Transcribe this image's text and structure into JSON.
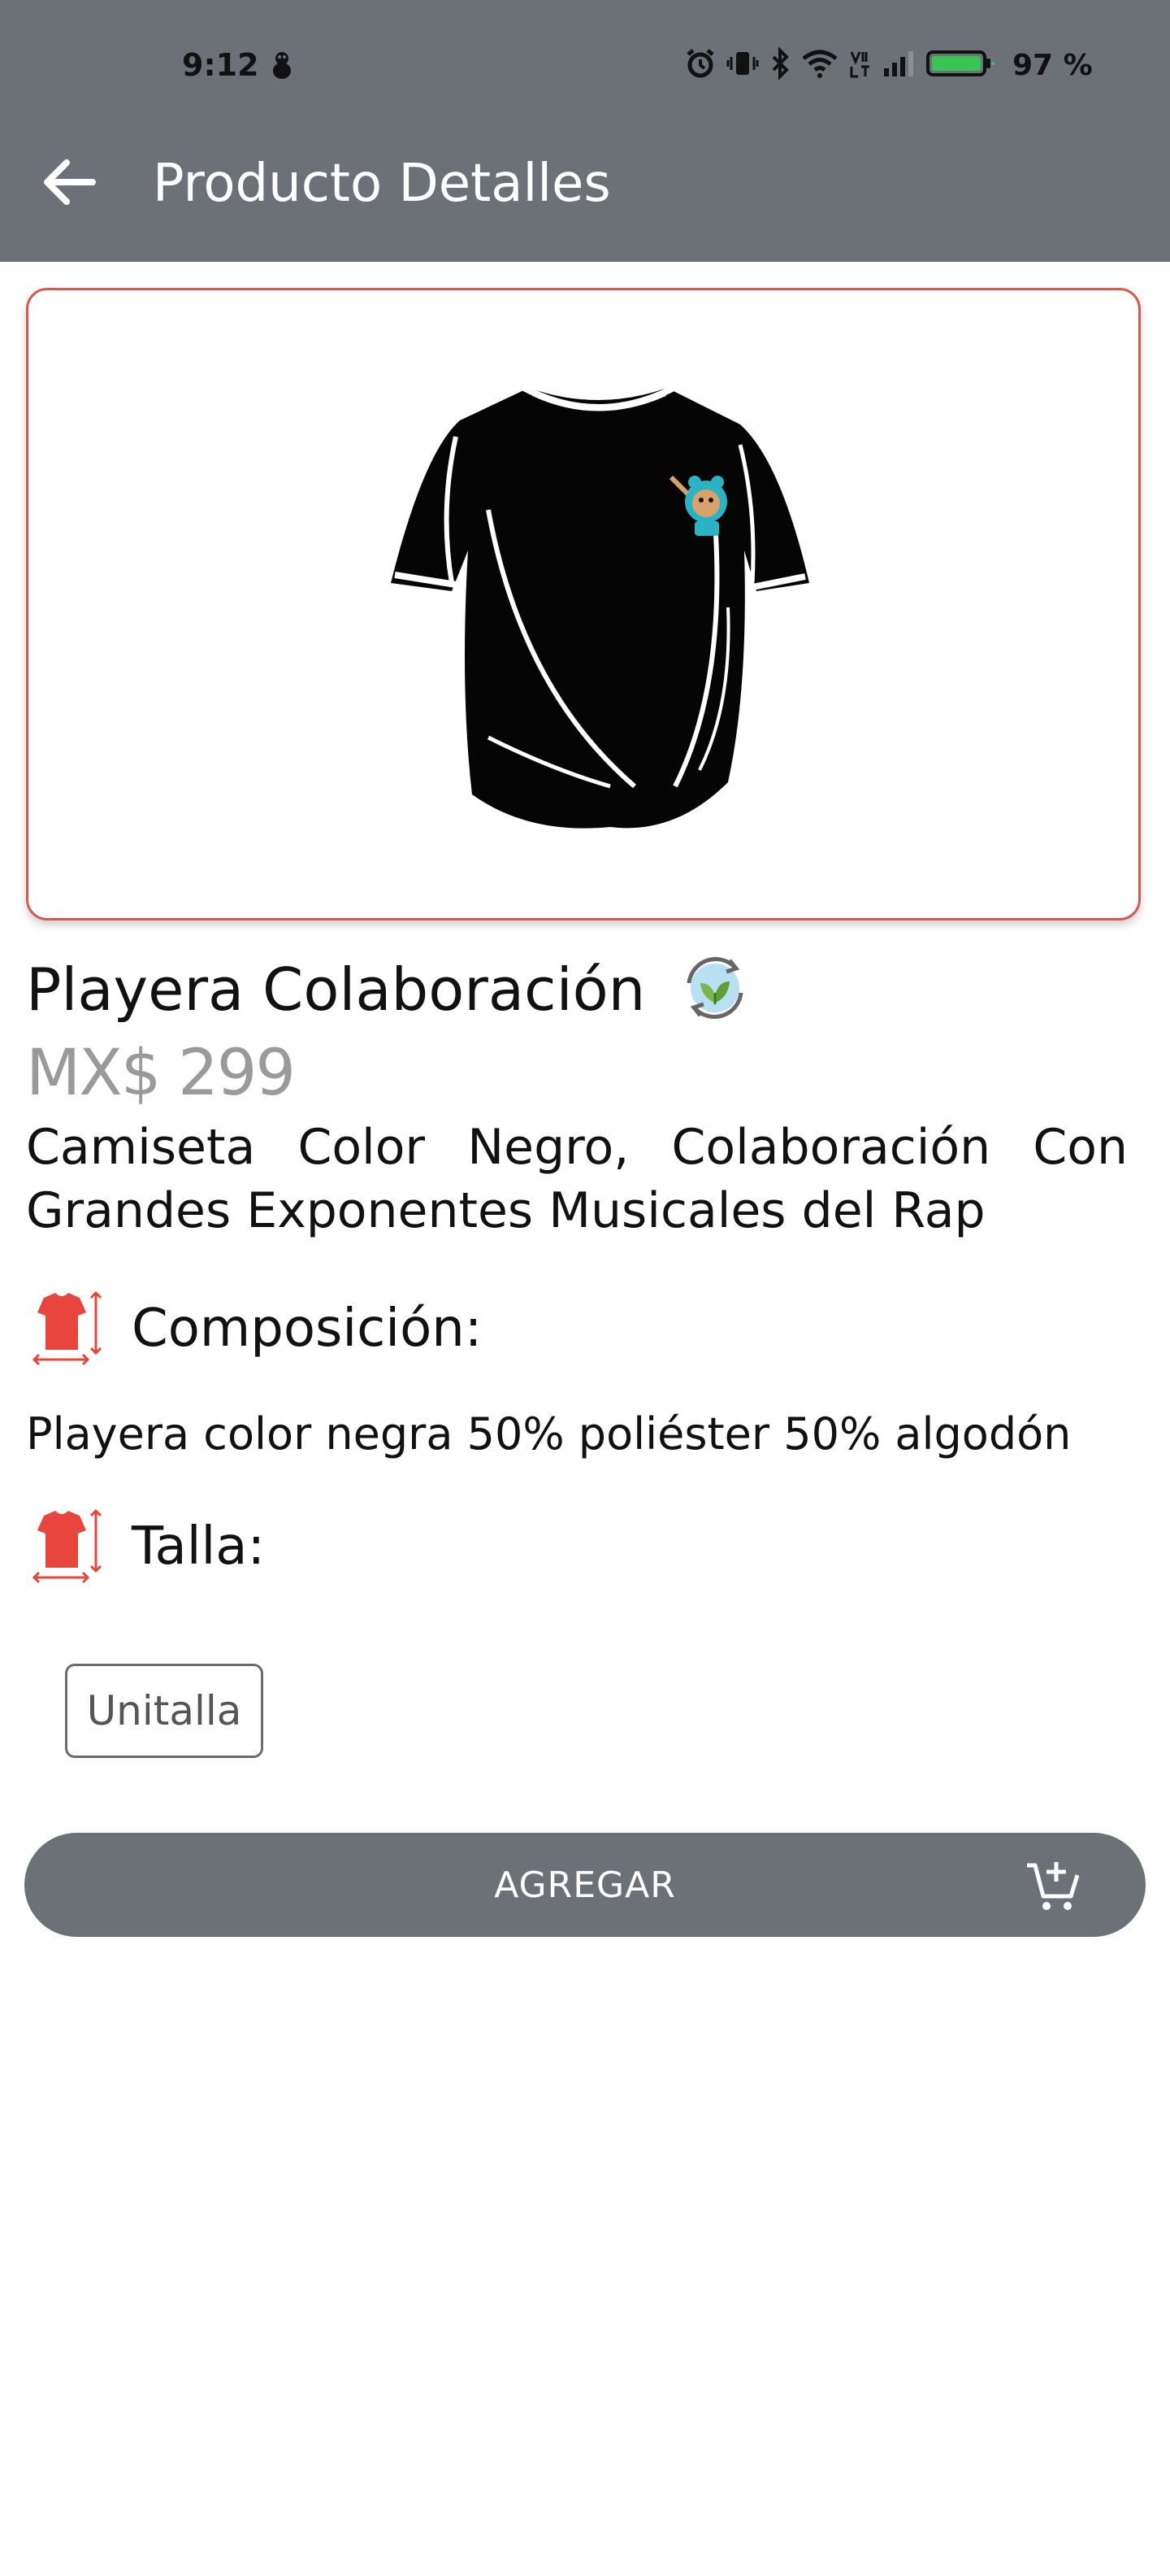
{
  "status_bar": {
    "time": "9:12",
    "battery": "97 %",
    "icons": [
      "notification-icon",
      "alarm-icon",
      "vibrate-icon",
      "bluetooth-icon",
      "wifi-icon",
      "volte-icon",
      "signal-icon",
      "battery-icon"
    ]
  },
  "app_bar": {
    "title": "Producto Detalles",
    "back_icon": "arrow-back-icon"
  },
  "product": {
    "image_icon": "black-tshirt-image",
    "title": "Playera Colaboración",
    "eco_icon": "eco-leaf-icon",
    "price": "MX$ 299",
    "description": "Camiseta Color Negro, Colaboración Con Grandes Exponentes Musicales del Rap"
  },
  "composition": {
    "label": "Composición:",
    "icon": "tshirt-size-icon",
    "text": "Playera color negra 50% poliéster 50% algodón"
  },
  "size": {
    "label": "Talla:",
    "icon": "tshirt-size-icon",
    "options": [
      "Unitalla"
    ]
  },
  "add_button": {
    "label": "AGREGAR",
    "icon": "add-to-cart-icon"
  },
  "colors": {
    "app_bar": "#6b7177",
    "accent_red": "#e8463c",
    "price_gray": "#9a9a9a",
    "card_border": "#d8584a"
  }
}
